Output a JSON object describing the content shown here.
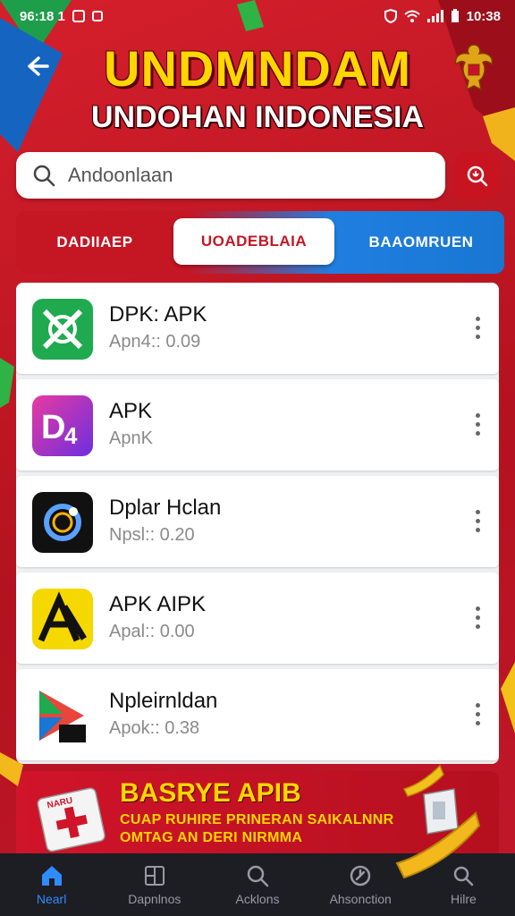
{
  "status_bar": {
    "time": "96:18 1",
    "right_time": "10:38"
  },
  "header": {
    "title": "UNDMNDAM",
    "subtitle": "UNDOHAN INDONESIA",
    "back_icon": "back-arrow-icon",
    "emblem_icon": "garuda-emblem-icon"
  },
  "search": {
    "placeholder": "Andoonlaan",
    "search_icon": "search-icon",
    "voice_icon": "voice-search-icon"
  },
  "tabs": [
    {
      "label": "DADIIAEP",
      "active": false
    },
    {
      "label": "UOADEBLAIA",
      "active": true
    },
    {
      "label": "BAAOMRUEN",
      "active": false
    }
  ],
  "apps": [
    {
      "name": "DPK: APK",
      "meta": "Apn4:: 0.09",
      "icon": "green-app-icon",
      "color": "#1faa4f"
    },
    {
      "name": "APK",
      "meta": "ApnK",
      "icon": "d4-app-icon",
      "color": "#9b2fd8"
    },
    {
      "name": "Dplar Hclan",
      "meta": "Npsl:: 0.20",
      "icon": "circle-app-icon",
      "color": "#111111"
    },
    {
      "name": "APK AIPK",
      "meta": "Apal:: 0.00",
      "icon": "yellow-a-app-icon",
      "color": "#f5d800"
    },
    {
      "name": "Npleirnldan",
      "meta": "Apok:: 0.38",
      "icon": "play-app-icon",
      "color": "#ffffff"
    }
  ],
  "banner": {
    "title": "BASRYE APIB",
    "line1": "CUAP RUHIRE PRINERAN SAIKALNNR",
    "line2": "OMTAG AN DERI NIRMMA",
    "tag": "NARU",
    "icon": "first-aid-kit-icon"
  },
  "bottom_nav": [
    {
      "label": "Nearl",
      "icon": "home-icon",
      "active": true
    },
    {
      "label": "Dapnlnos",
      "icon": "book-icon",
      "active": false
    },
    {
      "label": "Acklons",
      "icon": "search-icon",
      "active": false
    },
    {
      "label": "Ahsonction",
      "icon": "clock-icon",
      "active": false
    },
    {
      "label": "Hilre",
      "icon": "search-alt-icon",
      "active": false
    }
  ],
  "colors": {
    "primary_red": "#c8102e",
    "title_yellow": "#ffd600",
    "tab_blue": "#1976d2",
    "active_nav_blue": "#2f8bff"
  }
}
